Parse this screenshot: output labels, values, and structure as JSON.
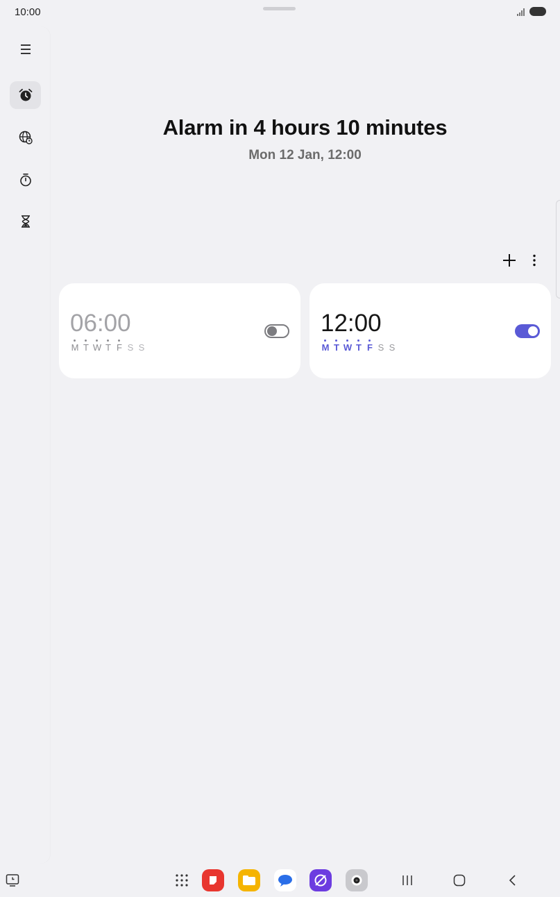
{
  "status_bar": {
    "time": "10:00"
  },
  "rail": {
    "items": [
      {
        "name": "menu",
        "icon": "menu-icon"
      },
      {
        "name": "alarm",
        "icon": "alarm-icon",
        "active": true
      },
      {
        "name": "world-clock",
        "icon": "globe-icon"
      },
      {
        "name": "stopwatch",
        "icon": "stopwatch-icon"
      },
      {
        "name": "timer",
        "icon": "hourglass-icon"
      }
    ]
  },
  "header": {
    "title": "Alarm in 4 hours 10 minutes",
    "subtitle": "Mon 12 Jan, 12:00"
  },
  "toolbar": {
    "add": "plus-icon",
    "more": "more-vertical-icon"
  },
  "alarms": [
    {
      "time": "06:00",
      "enabled": false,
      "days": [
        "M",
        "T",
        "W",
        "T",
        "F",
        "S",
        "S"
      ],
      "active_days": [
        true,
        true,
        true,
        true,
        true,
        false,
        false
      ]
    },
    {
      "time": "12:00",
      "enabled": true,
      "days": [
        "M",
        "T",
        "W",
        "T",
        "F",
        "S",
        "S"
      ],
      "active_days": [
        true,
        true,
        true,
        true,
        true,
        false,
        false
      ]
    }
  ],
  "colors": {
    "accent": "#5a5ad6",
    "background": "#f1f1f4",
    "card": "#ffffff"
  },
  "taskbar": {
    "apps": [
      "apps-grid-icon",
      "notes-app-icon",
      "files-app-icon",
      "messages-app-icon",
      "internet-app-icon",
      "camera-app-icon"
    ],
    "nav": [
      "recents-icon",
      "home-icon",
      "back-icon"
    ]
  }
}
